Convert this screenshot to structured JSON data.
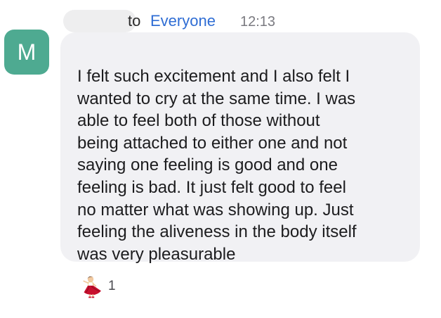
{
  "sender": {
    "avatar_initial": "M",
    "avatar_color": "#4eaa91",
    "name_redacted": true
  },
  "header": {
    "to_label": "to",
    "recipient": "Everyone",
    "timestamp": "12:13",
    "recipient_color": "#2f6dd4"
  },
  "message": {
    "text": "I felt such excitement and I also felt I\nwanted to cry at the same time.  I was\nable to feel both of those without\nbeing attached to either one and not\nsaying one feeling is good and one\nfeeling is bad.  It just felt good to feel\nno matter what was showing up.  Just\nfeeling the aliveness in the body itself\nwas very pleasurable"
  },
  "reactions": [
    {
      "icon": "dancer-icon",
      "count": "1"
    }
  ]
}
